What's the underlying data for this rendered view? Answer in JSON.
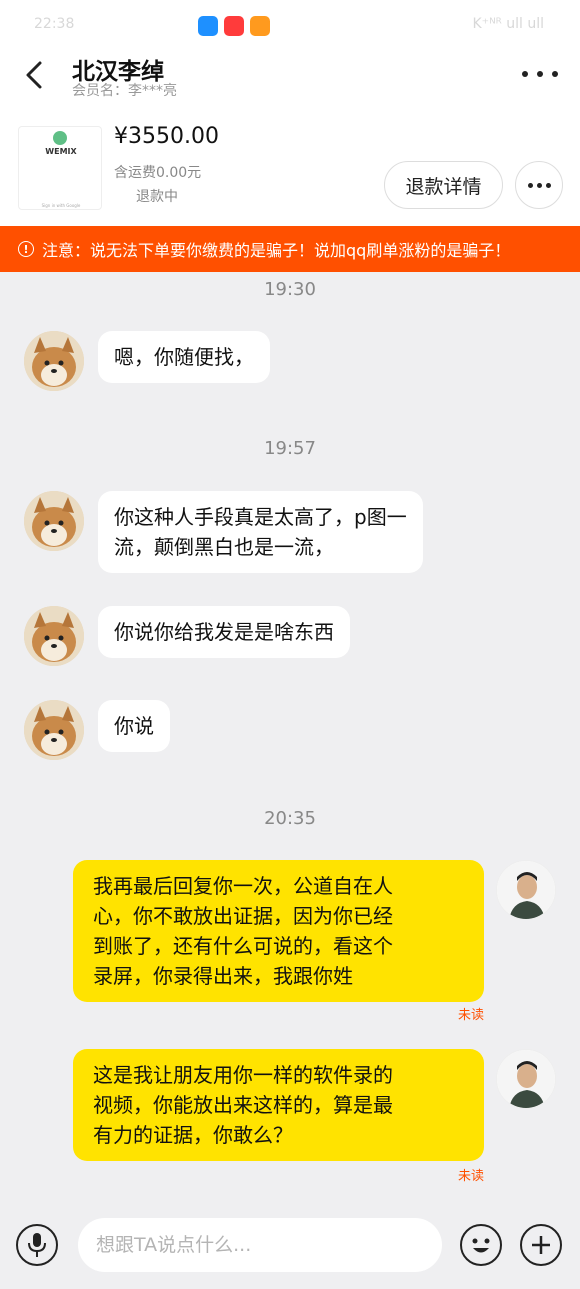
{
  "status_bar": {
    "time": "22:38",
    "signal": "K⁺ᴺᴿ ull ull"
  },
  "header": {
    "title": "北汉李绰",
    "member_label": "会员名：李***亮"
  },
  "order": {
    "thumb_logo_text": "WEMIX",
    "thumb_small_text": "Sign in with Google",
    "price": "¥3550.00",
    "shipping": "含运费0.00元",
    "status": "退款中",
    "refund_button": "退款详情"
  },
  "notice": {
    "text": "注意：说无法下单要你缴费的是骗子！说加qq刷单涨粉的是骗子！"
  },
  "messages": {
    "ts1": "19:30",
    "m1": "嗯，你随便找，",
    "ts2": "19:57",
    "m2_line1": "你这种人手段真是太高了，p图一",
    "m2_line2": "流，颠倒黑白也是一流，",
    "m3": "你说你给我发是是啥东西",
    "m4": "你说",
    "ts3": "20:35",
    "m5_line1": "我再最后回复你一次，公道自在人",
    "m5_line2": "心，你不敢放出证据，因为你已经",
    "m5_line3": "到账了，还有什么可说的，看这个",
    "m5_line4": "录屏，你录得出来，我跟你姓",
    "m5_status": "未读",
    "m6_line1": "这是我让朋友用你一样的软件录的",
    "m6_line2": "视频，你能放出来这样的，算是最",
    "m6_line3": "有力的证据，你敢么？",
    "m6_status": "未读"
  },
  "composer": {
    "placeholder": "想跟TA说点什么..."
  },
  "colors": {
    "accent": "#ff5000",
    "self_bubble": "#ffe300",
    "background": "#efeff1"
  }
}
